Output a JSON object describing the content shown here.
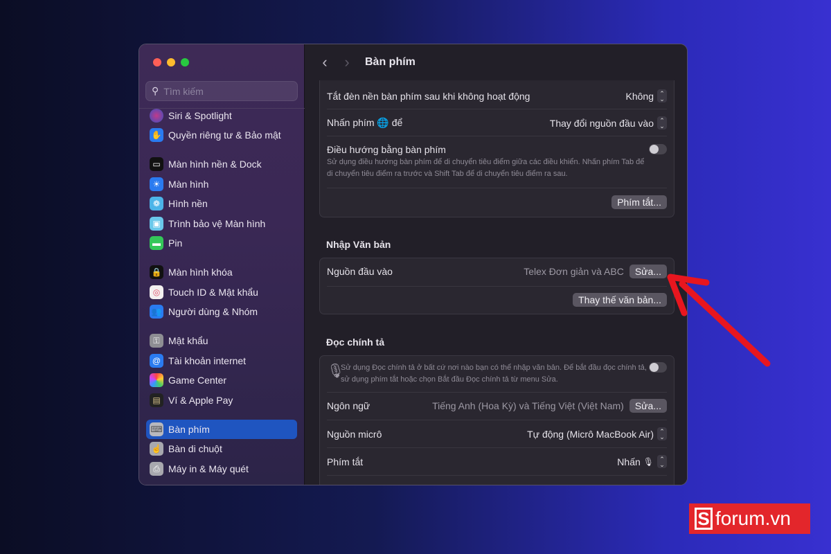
{
  "sidebar": {
    "search_placeholder": "Tìm kiếm",
    "items": [
      {
        "label": "Siri & Spotlight"
      },
      {
        "label": "Quyền riêng tư & Bảo mật"
      },
      {
        "label": "Màn hình nền & Dock"
      },
      {
        "label": "Màn hình"
      },
      {
        "label": "Hình nền"
      },
      {
        "label": "Trình bảo vệ Màn hình"
      },
      {
        "label": "Pin"
      },
      {
        "label": "Màn hình khóa"
      },
      {
        "label": "Touch ID & Mật khẩu"
      },
      {
        "label": "Người dùng & Nhóm"
      },
      {
        "label": "Mật khẩu"
      },
      {
        "label": "Tài khoản internet"
      },
      {
        "label": "Game Center"
      },
      {
        "label": "Ví & Apple Pay"
      },
      {
        "label": "Bàn phím"
      },
      {
        "label": "Bàn di chuột"
      },
      {
        "label": "Máy in & Máy quét"
      }
    ]
  },
  "header": {
    "title": "Bàn phím"
  },
  "keyboard": {
    "backlight_label": "Tắt đèn nền bàn phím sau khi không hoạt động",
    "backlight_value": "Không",
    "globe_label": "Nhấn phím 🌐 để",
    "globe_value": "Thay đổi nguồn đầu vào",
    "nav_label": "Điều hướng bằng bàn phím",
    "nav_desc": "Sử dụng điều hướng bàn phím để di chuyển tiêu điểm giữa các điều khiển. Nhấn phím Tab để di chuyển tiêu điểm ra trước và Shift Tab để di chuyển tiêu điểm ra sau.",
    "shortcuts_button": "Phím tắt..."
  },
  "text_input": {
    "section": "Nhập Văn bản",
    "source_label": "Nguồn đầu vào",
    "source_value": "Telex Đơn giản và ABC",
    "edit_button": "Sửa...",
    "replace_button": "Thay thế văn bản..."
  },
  "dictation": {
    "section": "Đọc chính tả",
    "desc": "Sử dụng Đọc chính tả ở bất cứ nơi nào bạn có thể nhập văn bản. Để bắt đầu đọc chính tả, sử dụng phím tắt hoặc chọn Bắt đầu Đọc chính tả từ menu Sửa.",
    "lang_label": "Ngôn ngữ",
    "lang_value": "Tiếng Anh (Hoa Kỳ) và Tiếng Việt (Việt Nam)",
    "lang_button": "Sửa...",
    "mic_label": "Nguồn micrô",
    "mic_value": "Tự động (Micrô MacBook Air)",
    "shortcut_label": "Phím tắt",
    "shortcut_value": "Nhấn"
  },
  "watermark": {
    "text": "forum.vn",
    "letter": "S"
  },
  "colors": {
    "selected": "#1f55c0",
    "arrow": "#e8161f"
  }
}
